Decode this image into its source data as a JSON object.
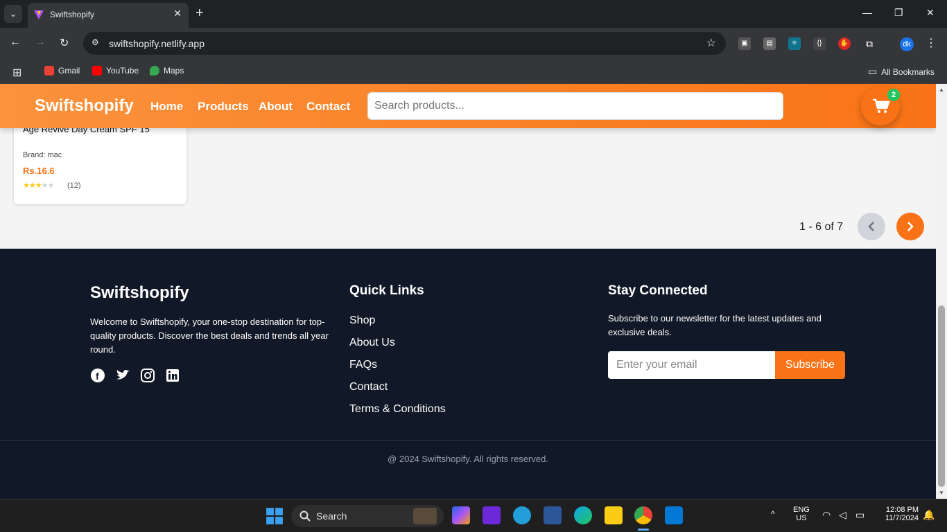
{
  "browser": {
    "tab_title": "Swiftshopify",
    "url": "swiftshopify.netlify.app",
    "bookmarks": [
      {
        "label": "Gmail",
        "color": "#ea4335"
      },
      {
        "label": "YouTube",
        "color": "#ff0000"
      },
      {
        "label": "Maps",
        "color": "#34a853"
      }
    ],
    "all_bookmarks": "All Bookmarks",
    "profile_initials": "dk"
  },
  "header": {
    "logo": "Swiftshopify",
    "nav": [
      "Home",
      "Products",
      "About",
      "Contact"
    ],
    "search_placeholder": "Search products...",
    "cart_count": "2"
  },
  "product": {
    "name": "Age Revive Day Cream SPF 15",
    "brand": "Brand: mac",
    "price": "Rs.16.6",
    "rating": 3,
    "rating_max": 5,
    "reviews": "(12)"
  },
  "pagination": {
    "label": "1 - 6 of 7"
  },
  "footer": {
    "brand": "Swiftshopify",
    "description": "Welcome to Swiftshopify, your one-stop destination for top-quality products. Discover the best deals and trends all year round.",
    "social": [
      "facebook-icon",
      "twitter-icon",
      "instagram-icon",
      "linkedin-icon"
    ],
    "quick_links_title": "Quick Links",
    "quick_links": [
      "Shop",
      "About Us",
      "FAQs",
      "Contact",
      "Terms & Conditions"
    ],
    "stay_title": "Stay Connected",
    "stay_desc": "Subscribe to our newsletter for the latest updates and exclusive deals.",
    "email_placeholder": "Enter your email",
    "subscribe": "Subscribe",
    "copyright": "@ 2024 Swiftshopify. All rights reserved."
  },
  "taskbar": {
    "search_label": "Search",
    "lang": "ENG",
    "region": "US",
    "time": "12:08 PM",
    "date": "11/7/2024"
  },
  "colors": {
    "accent": "#f97316",
    "footer_bg": "#111827",
    "badge": "#22c55e"
  }
}
